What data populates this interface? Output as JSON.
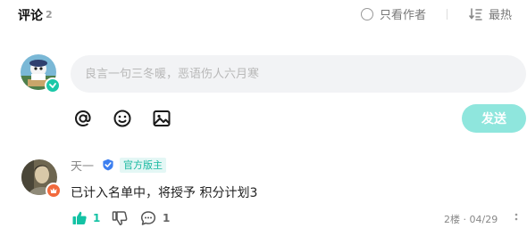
{
  "header": {
    "title": "评论",
    "count": "2",
    "only_author_label": "只看作者",
    "sort_label": "最热"
  },
  "composer": {
    "placeholder": "良言一句三冬暖，恶语伤人六月寒",
    "send_label": "发送",
    "tools": [
      "mention-icon",
      "emoji-icon",
      "image-icon"
    ]
  },
  "comments": [
    {
      "username": "天一",
      "role_tag": "官方版主",
      "content": "已计入名单中，将授予 积分计划3",
      "likes": "1",
      "replies": "1",
      "meta": "2楼 · 04/29"
    }
  ],
  "colors": {
    "accent": "#13c2a4",
    "send_disabled": "#8fe6dd",
    "input_bg": "#f2f3f5",
    "mod_badge": "#f26a3d",
    "verify_blue": "#3d7ff0"
  }
}
